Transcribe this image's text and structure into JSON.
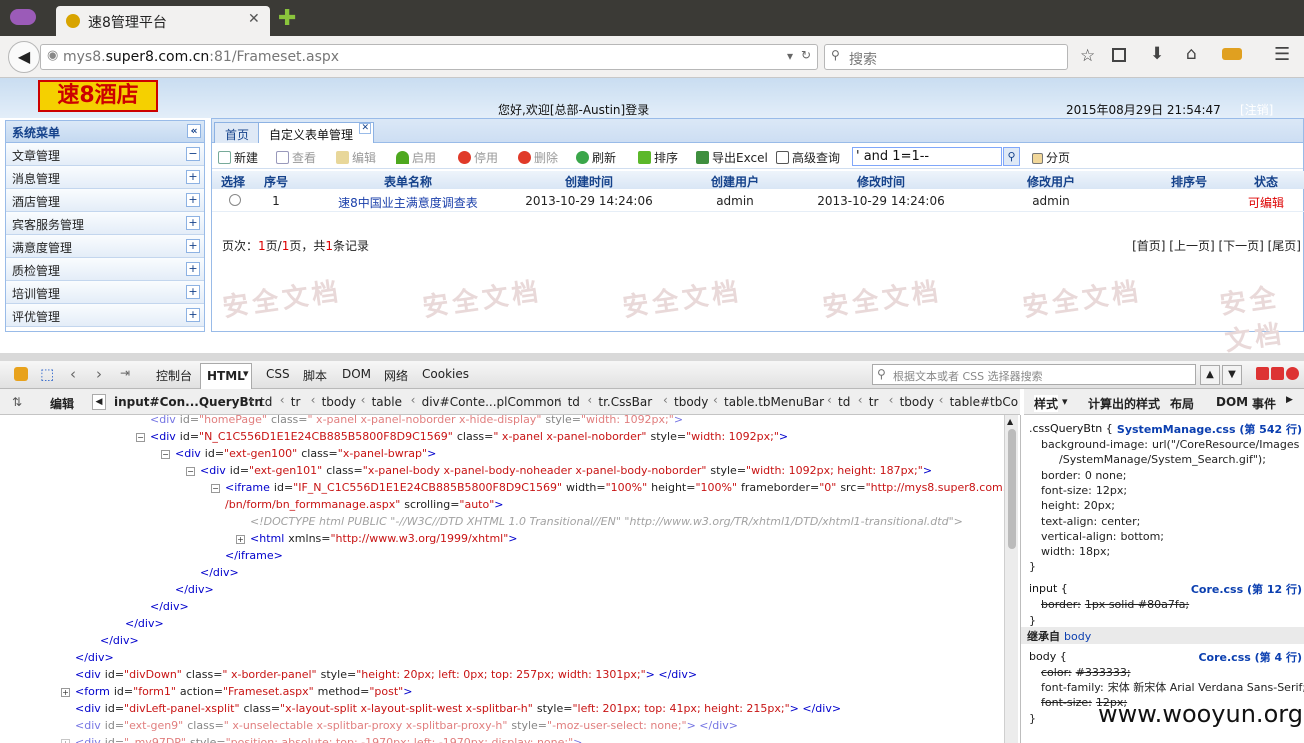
{
  "browser": {
    "tab_title": "速8管理平台",
    "url_host": "mys8.",
    "url_domain": "super8.com.cn",
    "url_rest": ":81/Frameset.aspx",
    "search_placeholder": "搜索"
  },
  "app": {
    "logo": "速8酒店",
    "welcome": "您好,欢迎[总部-Austin]登录",
    "datetime": "2015年08月29日 21:54:47",
    "logout": "[注销]"
  },
  "sidebar": {
    "title": "系统菜单",
    "items": [
      {
        "label": "文章管理",
        "toggle": "−"
      },
      {
        "label": "消息管理",
        "toggle": "+"
      },
      {
        "label": "酒店管理",
        "toggle": "+"
      },
      {
        "label": "宾客服务管理",
        "toggle": "+"
      },
      {
        "label": "满意度管理",
        "toggle": "+"
      },
      {
        "label": "质检管理",
        "toggle": "+"
      },
      {
        "label": "培训管理",
        "toggle": "+"
      },
      {
        "label": "评优管理",
        "toggle": "+"
      }
    ]
  },
  "panel": {
    "tabs": [
      "首页",
      "自定义表单管理"
    ],
    "toolbar": {
      "new": "新建",
      "view": "查看",
      "edit": "编辑",
      "enable": "启用",
      "disable": "停用",
      "delete": "删除",
      "refresh": "刷新",
      "sort": "排序",
      "export": "导出Excel",
      "advanced": "高级查询",
      "query_value": "' and 1=1--",
      "paging": "分页"
    },
    "grid": {
      "headers": [
        "选择",
        "序号",
        "表单名称",
        "创建时间",
        "创建用户",
        "修改时间",
        "修改用户",
        "排序号",
        "状态"
      ],
      "row": {
        "index": "1",
        "name": "速8中国业主满意度调查表",
        "created": "2013-10-29 14:24:06",
        "creator": "admin",
        "modified": "2013-10-29 14:24:06",
        "modifier": "admin",
        "sort": "",
        "status": "可编辑"
      }
    },
    "pager": {
      "prefix": "页次：",
      "cur": "1",
      "mid1": "页/",
      "total": "1",
      "mid2": "页，共",
      "count": "1",
      "suffix": "条记录",
      "nav": "[首页] [上一页] [下一页] [尾页]"
    },
    "watermark": "安全文档"
  },
  "devtools": {
    "tabs": [
      "控制台",
      "HTML",
      "CSS",
      "脚本",
      "DOM",
      "网络",
      "Cookies"
    ],
    "search_placeholder": "根据文本或者 CSS 选择器搜索",
    "edit": "编辑",
    "crumbs": [
      "input#Con...QueryBtn",
      "td",
      "tr",
      "tbody",
      "table",
      "div#Conte...plCommon",
      "td",
      "tr.CssBar",
      "tbody",
      "table.tbMenuBar",
      "td",
      "tr",
      "tbody",
      "table#tbCo"
    ],
    "side_tabs": [
      "样式",
      "计算出的样式",
      "布局",
      "DOM",
      "事件"
    ],
    "tree": [
      {
        "indent": 150,
        "tog": "",
        "dim": true,
        "tag": "<div",
        "attrs": [
          [
            "id",
            "\"homePage\""
          ],
          [
            "class",
            "\" x-panel x-panel-noborder x-hide-display\""
          ],
          [
            "style",
            "\"width: 1092px;\""
          ]
        ],
        "close": ">"
      },
      {
        "indent": 150,
        "tog": "−",
        "dim": false,
        "tag": "<div",
        "attrs": [
          [
            "id",
            "\"N_C1C556D1E1E24CB885B5800F8D9C1569\""
          ],
          [
            "class",
            "\" x-panel x-panel-noborder\""
          ],
          [
            "style",
            "\"width: 1092px;\""
          ]
        ],
        "close": ">"
      },
      {
        "indent": 175,
        "tog": "−",
        "dim": false,
        "tag": "<div",
        "attrs": [
          [
            "id",
            "\"ext-gen100\""
          ],
          [
            "class",
            "\"x-panel-bwrap\""
          ]
        ],
        "close": ">"
      },
      {
        "indent": 200,
        "tog": "−",
        "dim": false,
        "tag": "<div",
        "attrs": [
          [
            "id",
            "\"ext-gen101\""
          ],
          [
            "class",
            "\"x-panel-body x-panel-body-noheader x-panel-body-noborder\""
          ],
          [
            "style",
            "\"width: 1092px; height: 187px;\""
          ]
        ],
        "close": ">"
      },
      {
        "indent": 225,
        "tog": "−",
        "dim": false,
        "tag": "<iframe",
        "attrs": [
          [
            "id",
            "\"IF_N_C1C556D1E1E24CB885B5800F8D9C1569\""
          ],
          [
            "width",
            "\"100%\""
          ],
          [
            "height",
            "\"100%\""
          ],
          [
            "frameborder",
            "\"0\""
          ],
          [
            "src",
            "\"http://mys8.super8.com.cn:81/pages"
          ]
        ],
        "close": ""
      },
      {
        "indent": 225,
        "tog": "",
        "dim": false,
        "tag": "",
        "attrs": [
          [
            "",
            "/bn/form/bn_formmanage.aspx\""
          ],
          [
            "scrolling",
            "\"auto\""
          ]
        ],
        "close": ">"
      },
      {
        "indent": 250,
        "tog": "",
        "dim": true,
        "tag": "",
        "raw": "<!DOCTYPE html PUBLIC \"-//W3C//DTD XHTML 1.0 Transitional//EN\" \"http://www.w3.org/TR/xhtml1/DTD/xhtml1-transitional.dtd\">",
        "attrs": [],
        "close": ""
      },
      {
        "indent": 250,
        "tog": "+",
        "dim": false,
        "tag": "<html",
        "attrs": [
          [
            "xmlns",
            "\"http://www.w3.org/1999/xhtml\""
          ]
        ],
        "close": ">"
      },
      {
        "indent": 225,
        "tog": "",
        "dim": false,
        "tag": "</iframe>",
        "attrs": [],
        "close": ""
      },
      {
        "indent": 200,
        "tog": "",
        "dim": false,
        "tag": "</div>",
        "attrs": [],
        "close": ""
      },
      {
        "indent": 175,
        "tog": "",
        "dim": false,
        "tag": "</div>",
        "attrs": [],
        "close": ""
      },
      {
        "indent": 150,
        "tog": "",
        "dim": false,
        "tag": "</div>",
        "attrs": [],
        "close": ""
      },
      {
        "indent": 125,
        "tog": "",
        "dim": false,
        "tag": "</div>",
        "attrs": [],
        "close": ""
      },
      {
        "indent": 100,
        "tog": "",
        "dim": false,
        "tag": "</div>",
        "attrs": [],
        "close": ""
      },
      {
        "indent": 75,
        "tog": "",
        "dim": false,
        "tag": "</div>",
        "attrs": [],
        "close": ""
      },
      {
        "indent": 75,
        "tog": "",
        "dim": false,
        "tag": "<div",
        "attrs": [
          [
            "id",
            "\"divDown\""
          ],
          [
            "class",
            "\" x-border-panel\""
          ],
          [
            "style",
            "\"height: 20px; left: 0px; top: 257px; width: 1301px;\""
          ]
        ],
        "close": "> </div>"
      },
      {
        "indent": 75,
        "tog": "+",
        "dim": false,
        "tag": "<form",
        "attrs": [
          [
            "id",
            "\"form1\""
          ],
          [
            "action",
            "\"Frameset.aspx\""
          ],
          [
            "method",
            "\"post\""
          ]
        ],
        "close": ">"
      },
      {
        "indent": 75,
        "tog": "",
        "dim": false,
        "tag": "<div",
        "attrs": [
          [
            "id",
            "\"divLeft-panel-xsplit\""
          ],
          [
            "class",
            "\"x-layout-split x-layout-split-west x-splitbar-h\""
          ],
          [
            "style",
            "\"left: 201px; top: 41px; height: 215px;\""
          ]
        ],
        "close": "> </div>"
      },
      {
        "indent": 75,
        "tog": "",
        "dim": true,
        "tag": "<div",
        "attrs": [
          [
            "id",
            "\"ext-gen9\""
          ],
          [
            "class",
            "\" x-unselectable x-splitbar-proxy x-splitbar-proxy-h\""
          ],
          [
            "style",
            "\"-moz-user-select: none;\""
          ]
        ],
        "close": "> </div>"
      },
      {
        "indent": 75,
        "tog": "+",
        "dim": true,
        "tag": "<div",
        "attrs": [
          [
            "id",
            "\"_my97DP\""
          ],
          [
            "style",
            "\"position: absolute; top: -1970px; left: -1970px; display: none;\""
          ]
        ],
        "close": ">"
      }
    ],
    "styles": {
      "rule1": {
        "selector": ".cssQueryBtn {",
        "source": "SystemManage.css (第 542 行)",
        "props": [
          [
            "background-image:",
            "url(\"/CoreResource/Images"
          ],
          [
            "",
            "/SystemManage/System_Search.gif\");"
          ],
          [
            "border:",
            "0 none;"
          ],
          [
            "font-size:",
            "12px;"
          ],
          [
            "height:",
            "20px;"
          ],
          [
            "text-align:",
            "center;"
          ],
          [
            "vertical-align:",
            "bottom;"
          ],
          [
            "width:",
            "18px;"
          ]
        ]
      },
      "rule2": {
        "selector": "input {",
        "source": "Core.css (第 12 行)",
        "props": [
          [
            "border:",
            "1px solid #80a7fa;"
          ]
        ]
      },
      "inherit_label": "继承自",
      "inherit_tag": "body",
      "rule3": {
        "selector": "body {",
        "source": "Core.css (第 4 行)",
        "props": [
          [
            "color:",
            "#333333;"
          ],
          [
            "font-family:",
            "宋体 新宋体 Arial Verdana Sans-Serif;"
          ],
          [
            "font-size:",
            "12px;"
          ]
        ]
      },
      "close": "}"
    }
  },
  "watermark_site": "www.wooyun.org"
}
